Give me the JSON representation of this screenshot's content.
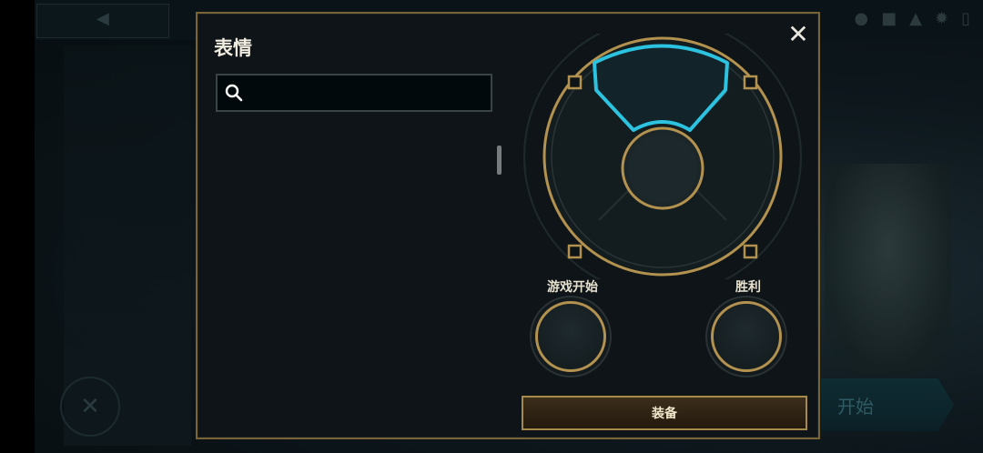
{
  "dialog": {
    "title": "表情",
    "search": {
      "value": "",
      "placeholder": ""
    },
    "close_icon": "close-icon",
    "slots": [
      {
        "label": "游戏开始"
      },
      {
        "label": "胜利"
      }
    ],
    "equip_label": "装备"
  },
  "background": {
    "start_label": "开始",
    "back_icon": "back-arrow-icon",
    "close_icon": "close-icon"
  },
  "colors": {
    "gold": "#b3924f",
    "cyan_highlight": "#2bc3e0",
    "panel_bg": "#0e1417"
  }
}
